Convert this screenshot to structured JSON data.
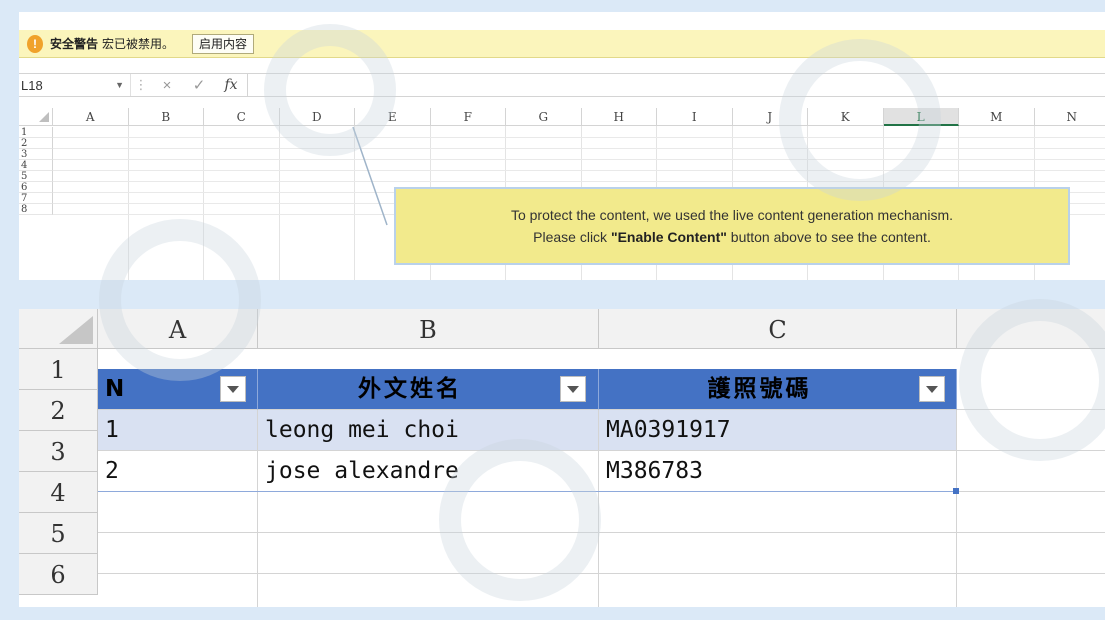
{
  "security_bar": {
    "title": "安全警告",
    "message": "宏已被禁用。",
    "enable_button": "启用内容"
  },
  "formula_bar": {
    "name_box": "L18",
    "separator": "⋮",
    "cancel_icon": "×",
    "confirm_icon": "✓",
    "fx_label": "fx",
    "formula": ""
  },
  "top_sheet": {
    "columns": [
      "A",
      "B",
      "C",
      "D",
      "E",
      "F",
      "G",
      "H",
      "I",
      "J",
      "K",
      "L",
      "M",
      "N"
    ],
    "selected_column": "L",
    "rows": [
      "1",
      "2",
      "3",
      "4",
      "5",
      "6",
      "7",
      "8"
    ]
  },
  "callout": {
    "line1": "To protect the content, we used the live content generation mechanism.",
    "line2_prefix": "Please click ",
    "line2_bold": "\"Enable Content\"",
    "line2_suffix": " button above to see the content."
  },
  "bottom_sheet": {
    "columns": [
      "A",
      "B",
      "C"
    ],
    "rows": [
      "1",
      "2",
      "3",
      "4",
      "5",
      "6"
    ],
    "table": {
      "headers": [
        "N",
        "外文姓名",
        "護照號碼"
      ],
      "data": [
        [
          "1",
          "leong mei choi",
          "MA0391917"
        ],
        [
          "2",
          "jose alexandre",
          "M386783"
        ]
      ]
    }
  },
  "colors": {
    "table_header": "#4472c4",
    "table_band": "#d9e1f2",
    "security_bar": "#fbf5bc",
    "callout": "#f2ea8c",
    "selected_column_accent": "#217346"
  },
  "icons": {
    "warning": "warning-icon",
    "filter": "filter-dropdown-icon"
  }
}
